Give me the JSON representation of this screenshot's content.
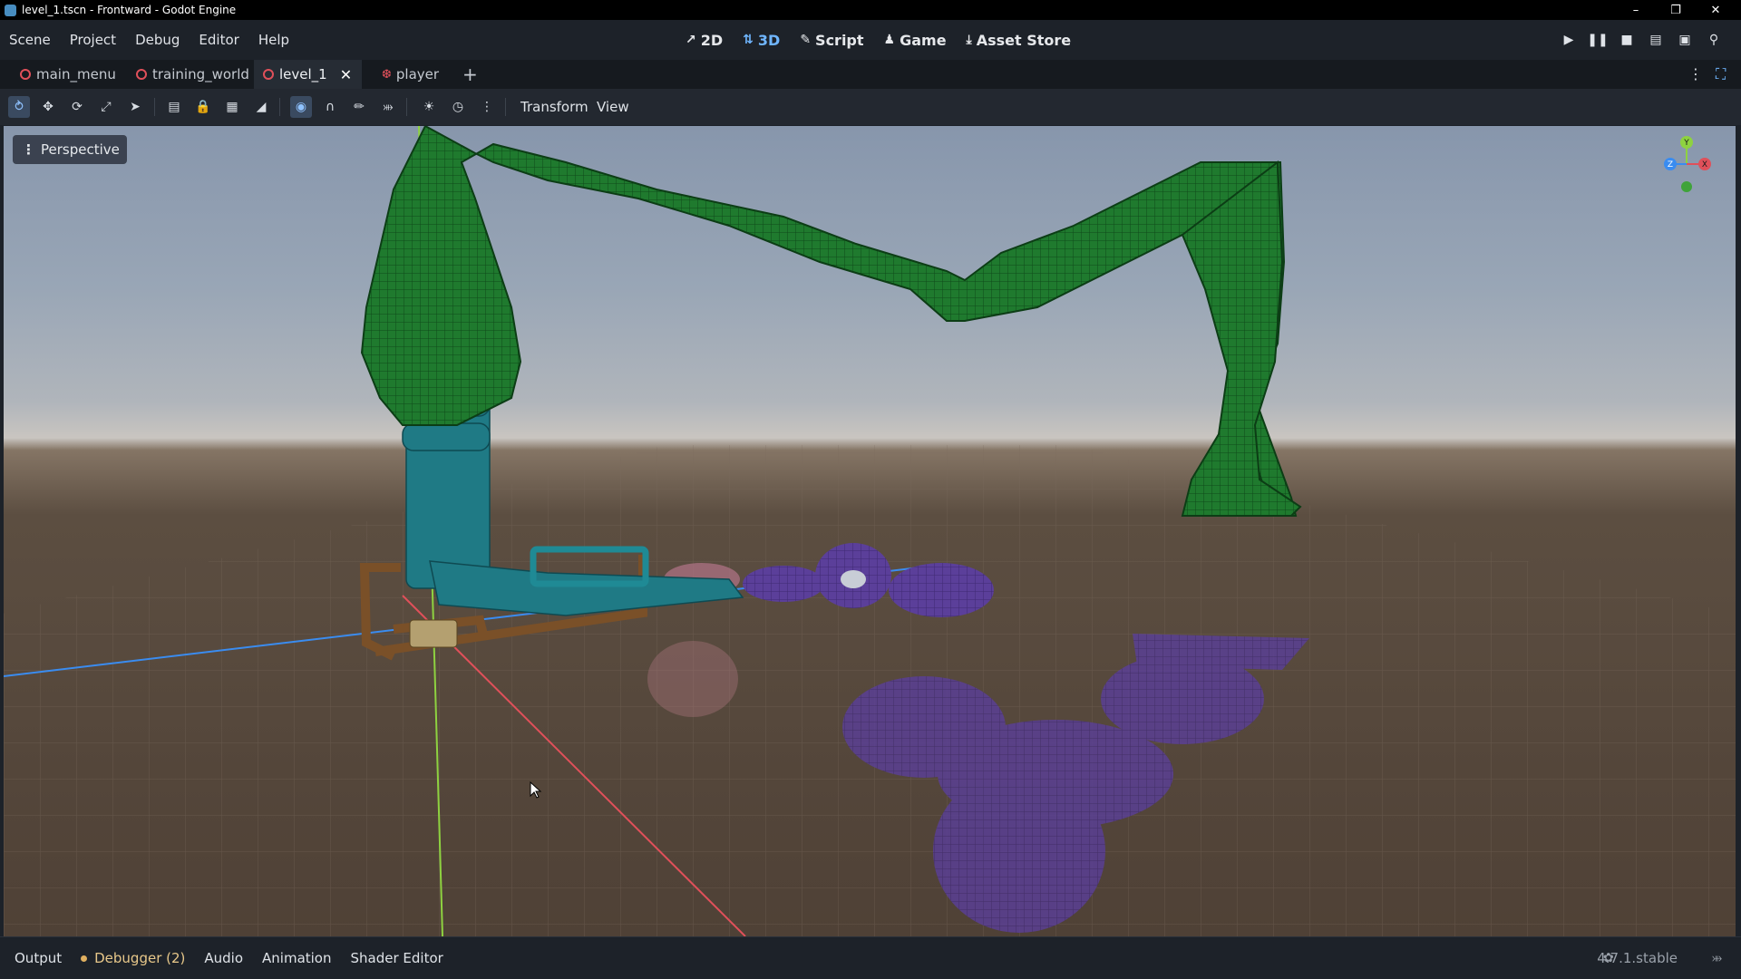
{
  "window": {
    "title": "level_1.tscn - Frontward - Godot Engine",
    "controls": [
      "minimize",
      "restore",
      "close"
    ]
  },
  "menu": [
    "Scene",
    "Project",
    "Debug",
    "Editor",
    "Help"
  ],
  "main_screens": [
    {
      "label": "2D",
      "icon": "2d-icon"
    },
    {
      "label": "3D",
      "icon": "3d-icon",
      "active": true
    },
    {
      "label": "Script",
      "icon": "script-icon"
    },
    {
      "label": "Game",
      "icon": "game-icon"
    },
    {
      "label": "Asset Store",
      "icon": "download-icon"
    }
  ],
  "scene_tabs": [
    {
      "label": "main_menu",
      "icon": "scene-icon"
    },
    {
      "label": "training_world",
      "icon": "scene-icon"
    },
    {
      "label": "level_1",
      "icon": "scene-icon",
      "active": true
    },
    {
      "label": "player",
      "icon": "player-icon"
    }
  ],
  "toolbar": {
    "transform_menu": "Transform",
    "view_menu": "View"
  },
  "viewport": {
    "camera_mode": "Perspective",
    "gizmo_axes": [
      "Y",
      "X",
      "Z"
    ],
    "colors": {
      "x_axis": "#e0505a",
      "y_axis": "#8ed240",
      "z_axis": "#3a8cf0",
      "mesh_green": "#1f7a2e",
      "mesh_teal": "#1f7a85",
      "mesh_purple": "#5b3f9a"
    }
  },
  "bottom_panel": {
    "tabs": [
      "Output",
      "Debugger (2)",
      "Audio",
      "Animation",
      "Shader Editor"
    ],
    "version": "4.7.1.stable"
  }
}
